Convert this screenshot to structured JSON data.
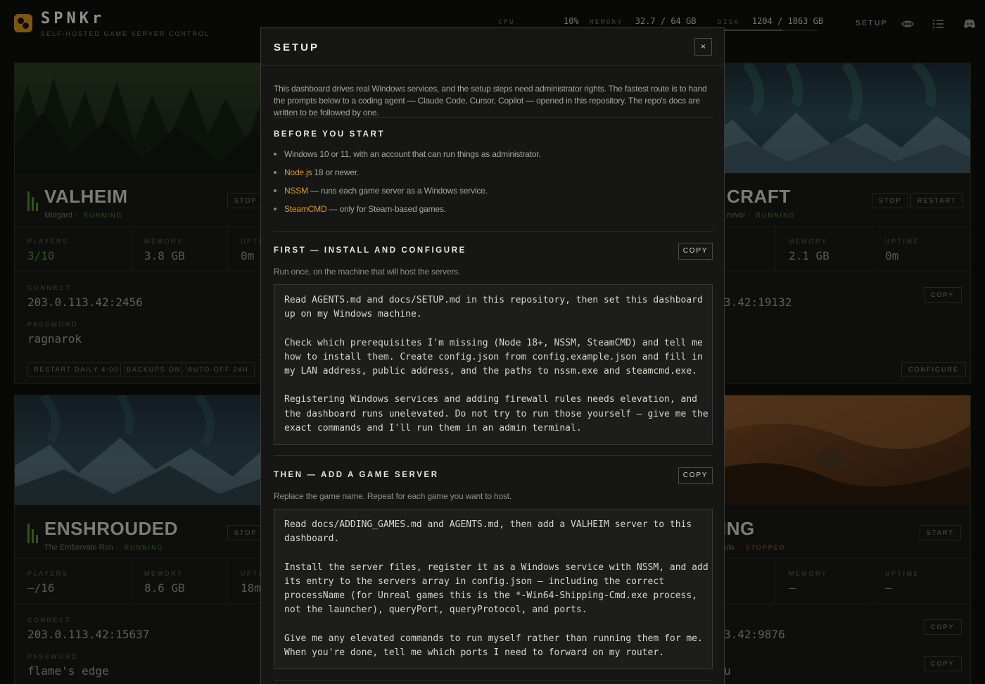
{
  "app": {
    "brand": "SPNKr",
    "tagline": "SELF-HOSTED GAME SERVER CONTROL",
    "accent": "#d89a2c"
  },
  "header": {
    "cpu": {
      "label": "CPU",
      "value": "10%",
      "usage": 0.1
    },
    "memory": {
      "label": "MEMORY",
      "value": "32.7 / 64 GB",
      "usage": 0.51
    },
    "disk": {
      "label": "DISK",
      "value": "1204 / 1863 GB",
      "usage": 0.65
    },
    "setup_label": "SETUP",
    "icons": [
      "eye-icon",
      "list-icon",
      "discord-icon"
    ]
  },
  "cards": {
    "valheim": {
      "name": "VALHEIM",
      "world": "Midgard",
      "status": "RUNNING",
      "stop": "STOP",
      "players_label": "PLAYERS",
      "players": "3/10",
      "memory_label": "MEMORY",
      "memory": "3.8 GB",
      "uptime_label": "UPTI",
      "uptime": "0m",
      "connect_label": "CONNECT",
      "connect": "203.0.113.42:2456",
      "password_label": "PASSWORD",
      "password": "ragnarok",
      "tags": [
        "RESTART DAILY 4:00",
        "BACKUPS ON",
        "AUTO-OFF 24H"
      ]
    },
    "craft": {
      "name": "CRAFT",
      "world": "rvival",
      "status": "RUNNING",
      "stop": "STOP",
      "restart": "RESTART",
      "memory_label": "MEMORY",
      "memory": "2.1 GB",
      "uptime_label": "UPTIME",
      "uptime": "0m",
      "connect": "3.42:19132",
      "copy": "COPY",
      "configure": "CONFIGURE"
    },
    "enshrouded": {
      "name": "ENSHROUDED",
      "world": "The Embervale Run",
      "status": "RUNNING",
      "stop": "STOP",
      "players_label": "PLAYERS",
      "players": "—/16",
      "memory_label": "MEMORY",
      "memory": "8.6 GB",
      "uptime_label": "UPTI",
      "uptime": "18m",
      "connect_label": "CONNECT",
      "connect": "203.0.113.42:15637",
      "password_label": "PASSWORD",
      "password": "flame's edge"
    },
    "ing": {
      "name": "ING",
      "world": "ula",
      "status": "STOPPED",
      "start": "START",
      "memory_label": "MEMORY",
      "memory": "—",
      "uptime_label": "UPTIME",
      "uptime": "—",
      "connect": "3.42:9876",
      "copy": "COPY",
      "copy2": "COPY",
      "password": "u"
    }
  },
  "modal": {
    "title": "SETUP",
    "close": "×",
    "intro": "This dashboard drives real Windows services, and the setup steps need administrator rights. The fastest route is to hand the prompts below to a coding agent — Claude Code, Cursor, Copilot — opened in this repository. The repo's docs are written to be followed by one.",
    "before": {
      "title": "BEFORE YOU START",
      "items": [
        {
          "link": "",
          "text": "Windows 10 or 11, with an account that can run things as administrator."
        },
        {
          "link": "Node.js",
          "text": " 18 or newer."
        },
        {
          "link": "NSSM",
          "text": " — runs each game server as a Windows service."
        },
        {
          "link": "SteamCMD",
          "text": " — only for Steam-based games."
        }
      ]
    },
    "first": {
      "title": "FIRST — INSTALL AND CONFIGURE",
      "copy": "COPY",
      "sub": "Run once, on the machine that will host the servers.",
      "code": [
        [
          "Read AGENTS.md and docs/SETUP.md in this repository, then set this dashboard",
          "up on my Windows machine."
        ],
        [
          "Check which prerequisites I'm missing (Node 18+, NSSM, SteamCMD) and tell me",
          "how to install them. Create config.json from config.example.json and fill in",
          "my LAN address, public address, and the paths to nssm.exe and steamcmd.exe."
        ],
        [
          "Registering Windows services and adding firewall rules needs elevation, and",
          "the dashboard runs unelevated. Do not try to run those yourself — give me the",
          "exact commands and I'll run them in an admin terminal."
        ]
      ]
    },
    "then": {
      "title": "THEN — ADD A GAME SERVER",
      "copy": "COPY",
      "sub": "Replace the game name. Repeat for each game you want to host.",
      "code": [
        [
          "Read docs/ADDING_GAMES.md and AGENTS.md, then add a VALHEIM server to this",
          "dashboard."
        ],
        [
          "Install the server files, register it as a Windows service with NSSM, and add",
          "its entry to the servers array in config.json — including the correct",
          "processName (for Unreal games this is the *-Win64-Shipping-Cmd.exe process,",
          "not the launcher), queryPort, queryProtocol, and ports."
        ],
        [
          "Give me any elevated commands to run myself rather than running them for me.",
          "When you're done, tell me which ports I need to forward on my router."
        ]
      ]
    }
  }
}
